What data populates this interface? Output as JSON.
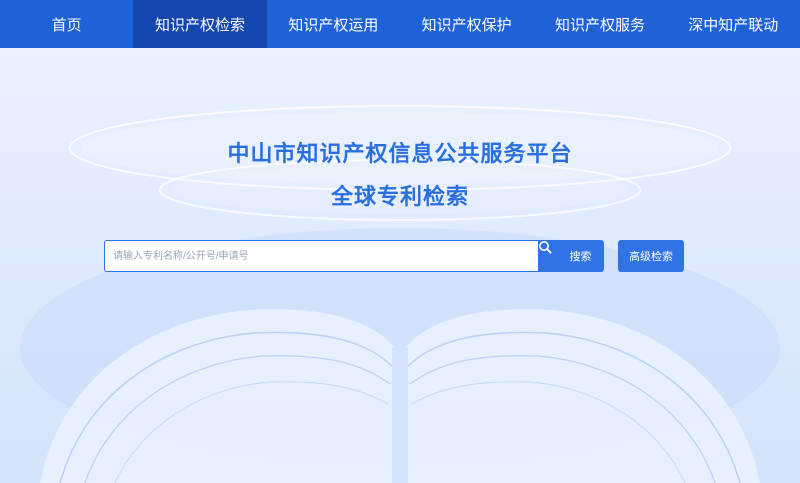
{
  "nav": {
    "items": [
      {
        "label": "首页",
        "active": false
      },
      {
        "label": "知识产权检索",
        "active": true
      },
      {
        "label": "知识产权运用",
        "active": false
      },
      {
        "label": "知识产权保护",
        "active": false
      },
      {
        "label": "知识产权服务",
        "active": false
      },
      {
        "label": "深中知产联动",
        "active": false
      }
    ]
  },
  "hero": {
    "title": "中山市知识产权信息公共服务平台",
    "subtitle": "全球专利检索"
  },
  "search": {
    "placeholder": "请输入专利名称/公开号/申请号",
    "value": "",
    "search_label": "搜索",
    "search_icon": "search-icon",
    "advanced_label": "高级检索"
  },
  "colors": {
    "nav_bg": "#1f62d8",
    "nav_active_bg": "#1548ae",
    "accent": "#2f73e6",
    "title": "#2a6fe0",
    "hero_bg": "#e9f1ff"
  }
}
